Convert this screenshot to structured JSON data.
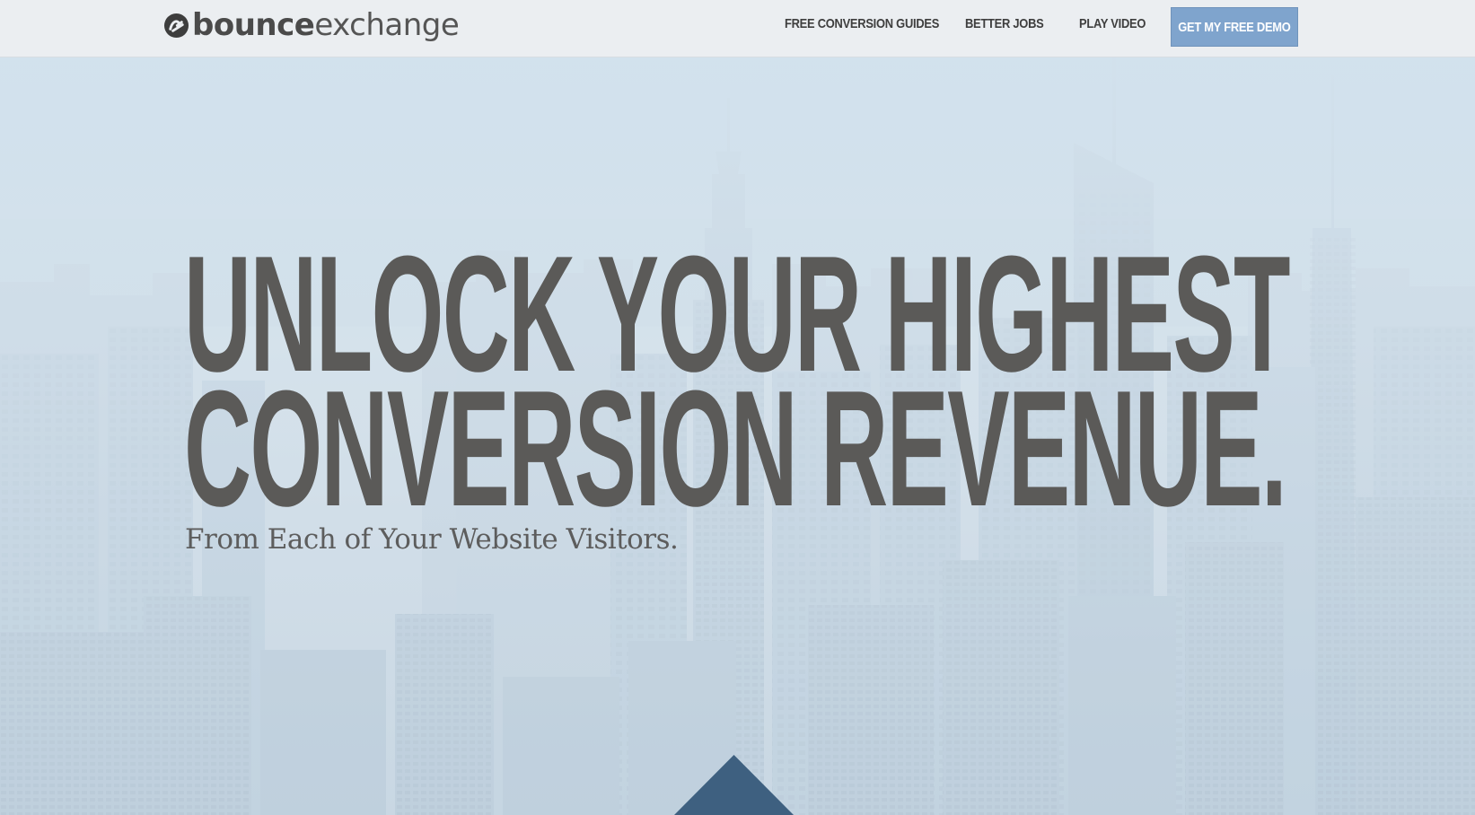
{
  "header": {
    "logo": {
      "bold": "bounce",
      "light": "exchange",
      "icon": "bounce-exchange-logo-icon"
    },
    "nav": [
      {
        "label": "FREE CONVERSION GUIDES"
      },
      {
        "label": "BETTER JOBS"
      },
      {
        "label": "PLAY VIDEO"
      }
    ],
    "cta_label": "GET MY FREE DEMO"
  },
  "hero": {
    "headline_line1": "UNLOCK YOUR HIGHEST",
    "headline_line2": "CONVERSION REVENUE.",
    "subheadline": "From Each of Your Website Visitors.",
    "scroll_icon": "triangle-up-icon"
  },
  "colors": {
    "header_bg": "#ebeef1",
    "cta_bg": "#7fa4cd",
    "headline": "#5b5a58",
    "arrow": "#3e6080"
  }
}
